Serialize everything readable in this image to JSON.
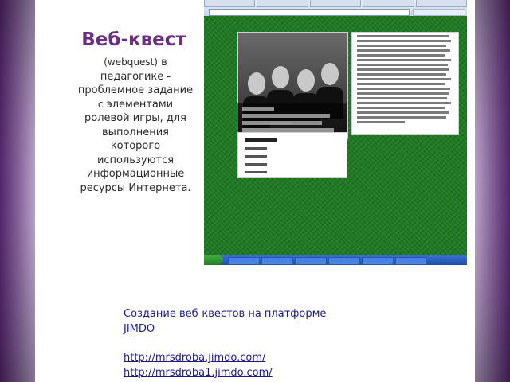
{
  "slide": {
    "heading": "Веб-квест",
    "description_part1": "(webquest)",
    "description_part2": "в педагогике - проблемное задание",
    "description_part3": "с",
    "description_part4": "элементами ролевой игры, для выполнения которого используются информационные ресурсы Интернета."
  },
  "links": {
    "title_line1": "Создание веб-квестов на платформе",
    "title_line2": "JIMDO",
    "url1": "http://mrsdroba.jimdo.com/",
    "url2": "http://mrsdroba1.jimdo.com/"
  },
  "colors": {
    "heading": "#6b2c82",
    "link": "#1a1a8c",
    "page_green": "#1c7a1f",
    "frame_purple": "#5a2a75"
  }
}
